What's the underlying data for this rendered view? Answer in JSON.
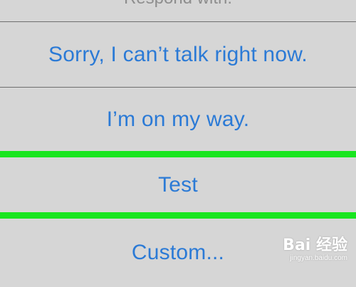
{
  "header": {
    "title": "Respond with:"
  },
  "options": [
    {
      "label": "Sorry, I can’t talk right now."
    },
    {
      "label": "I’m on my way."
    },
    {
      "label": "Test"
    },
    {
      "label": "Custom..."
    }
  ],
  "highlight_color": "#18e51f",
  "text_color": "#2b7ad6",
  "watermark": {
    "logo": "Bai  经验",
    "url": "jingyan.baidu.com"
  }
}
